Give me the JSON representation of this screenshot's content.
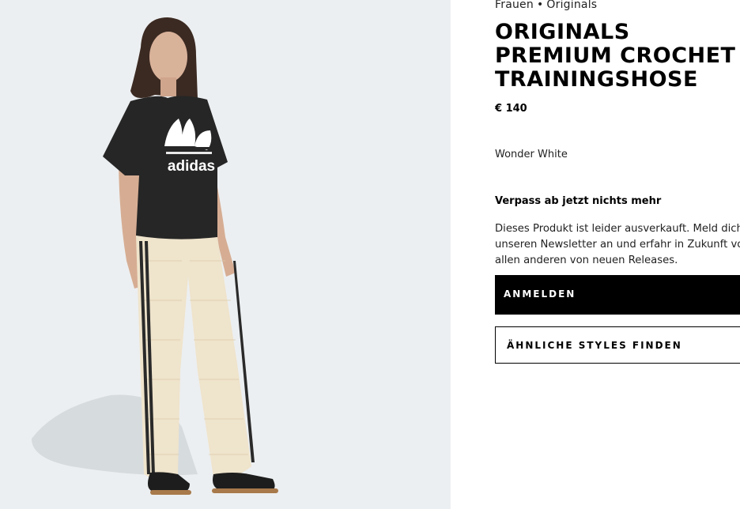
{
  "product_image": {
    "alt": "Model wearing black adidas t-shirt and cream crochet track pants",
    "shirt_logo_text": "adidas"
  },
  "breadcrumb": {
    "category": "Frauen",
    "separator": "•",
    "collection": "Originals"
  },
  "product": {
    "title": "ORIGINALS PREMIUM CROCHET TRAININGSHOSE",
    "price": "€ 140",
    "color": "Wonder White"
  },
  "notify": {
    "heading": "Verpass ab jetzt nichts mehr",
    "line1": "Dieses Produkt ist leider ausverkauft. Meld dich",
    "line2": "unseren Newsletter an und erfahr in Zukunft vo",
    "line3": "allen anderen von neuen Releases."
  },
  "buttons": {
    "signup_label": "ANMELDEN",
    "signup_arrow": "→",
    "similar_label": "ÄHNLICHE STYLES FINDEN"
  },
  "colors": {
    "panel_bg": "#eceff1",
    "primary": "#000000",
    "pants": "#efe4cc",
    "shirt": "#262626"
  }
}
